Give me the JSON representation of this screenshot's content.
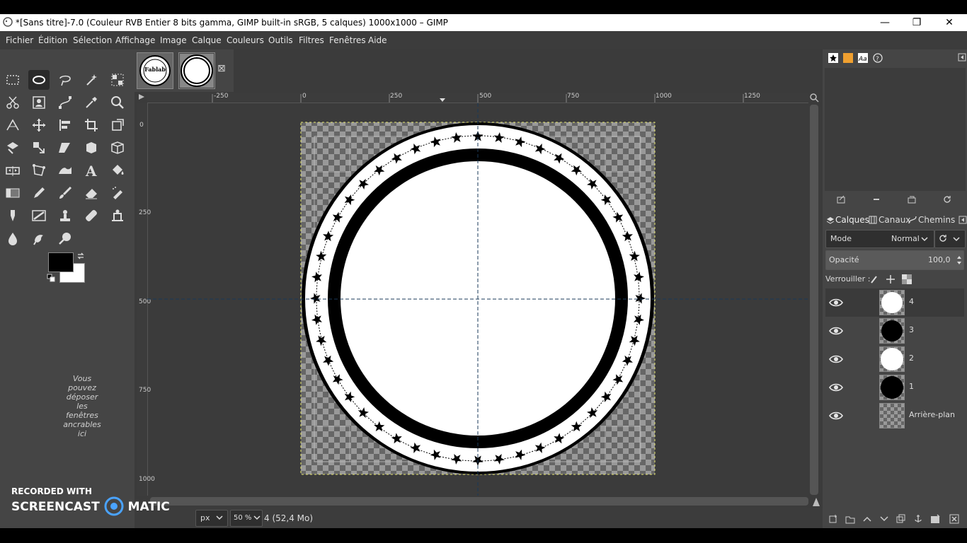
{
  "window": {
    "title": "*[Sans titre]-7.0 (Couleur RVB Entier 8 bits gamma, GIMP built-in sRGB, 5 calques) 1000x1000 – GIMP",
    "minimize": "—",
    "maximize": "❐",
    "close": "✕"
  },
  "menu": [
    "Fichier",
    "Édition",
    "Sélection",
    "Affichage",
    "Image",
    "Calque",
    "Couleurs",
    "Outils",
    "Filtres",
    "Fenêtres",
    "Aide"
  ],
  "toolbox": {
    "dock_hint": "Vous pouvez déposer les fenêtres ancrables ici",
    "fg_color": "#000000",
    "bg_color": "#ffffff"
  },
  "image_tabs": {
    "tab1_label": "Fablab",
    "close": "⊠"
  },
  "rulers": {
    "h": [
      "-250",
      "0",
      "250",
      "500",
      "750",
      "1000",
      "1250"
    ],
    "v": [
      "0",
      "250",
      "500",
      "750",
      "1000"
    ]
  },
  "status": {
    "unit": "px",
    "zoom": "50 %",
    "info": "4 (52,4 Mo)"
  },
  "layers_panel": {
    "tabs": [
      "Calques",
      "Canaux",
      "Chemins"
    ],
    "mode_label": "Mode",
    "mode_value": "Normal",
    "opacity_label": "Opacité",
    "opacity_value": "100,0",
    "lock_label": "Verrouiller :",
    "layers": [
      {
        "name": "4",
        "thumb": "white-circle"
      },
      {
        "name": "3",
        "thumb": "black-circle"
      },
      {
        "name": "2",
        "thumb": "white-circle"
      },
      {
        "name": "1",
        "thumb": "black-circle"
      },
      {
        "name": "Arrière-plan",
        "thumb": "checker"
      }
    ]
  },
  "watermark": {
    "line1": "RECORDED WITH",
    "line2a": "SCREENCAST",
    "line2b": "MATIC"
  }
}
